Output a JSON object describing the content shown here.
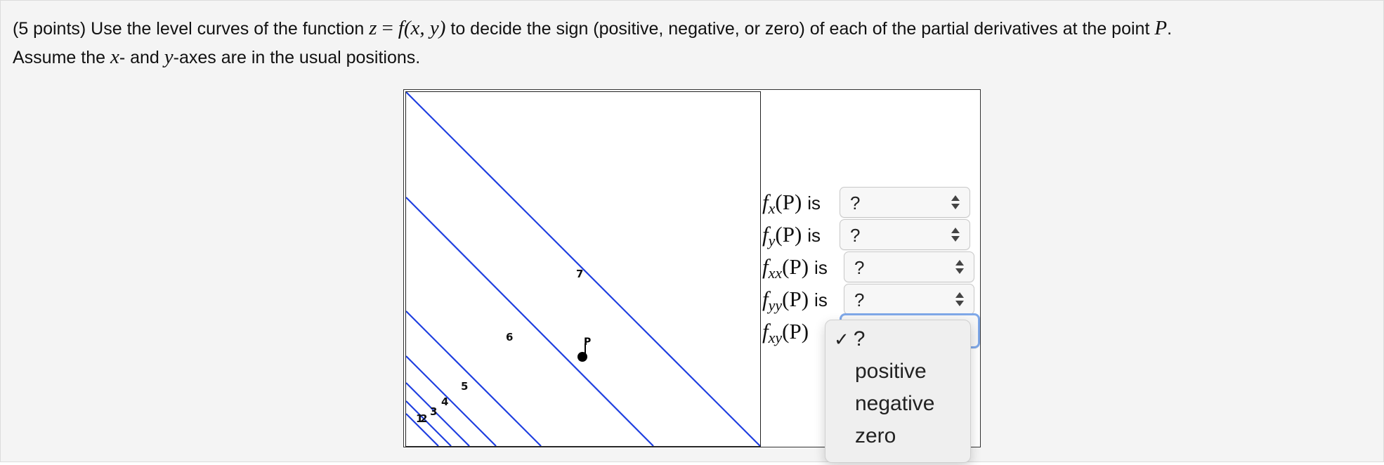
{
  "question": {
    "points": "(5 points)",
    "text_part1": "Use the level curves of the function",
    "func_z": "z",
    "func_eq": "=",
    "func_f": "f",
    "func_args": "(x, y)",
    "text_part2": "to decide the sign (positive, negative, or zero) of each of the partial derivatives at the point",
    "point_P": "P",
    "period": ".",
    "text_line2a": "Assume the",
    "x_var": "x",
    "text_line2b": "- and",
    "y_var": "y",
    "text_line2c": "-axes are in the usual positions."
  },
  "plot": {
    "level_labels": [
      "1",
      "2",
      "3",
      "4",
      "5",
      "6",
      "7"
    ],
    "point_label": "P",
    "line_color": "#1f3fe0"
  },
  "rows": [
    {
      "fn": "f",
      "sub": "x",
      "arg": "(P)",
      "is": "is",
      "value": "?"
    },
    {
      "fn": "f",
      "sub": "y",
      "arg": "(P)",
      "is": "is",
      "value": "?"
    },
    {
      "fn": "f",
      "sub": "xx",
      "arg": "(P)",
      "is": "is",
      "value": "?"
    },
    {
      "fn": "f",
      "sub": "yy",
      "arg": "(P)",
      "is": "is",
      "value": "?"
    },
    {
      "fn": "f",
      "sub": "xy",
      "arg": "(P)",
      "is": "",
      "value": "?"
    }
  ],
  "dropdown": {
    "selected_mark": "✓",
    "options": [
      "?",
      "positive",
      "negative",
      "zero"
    ]
  }
}
